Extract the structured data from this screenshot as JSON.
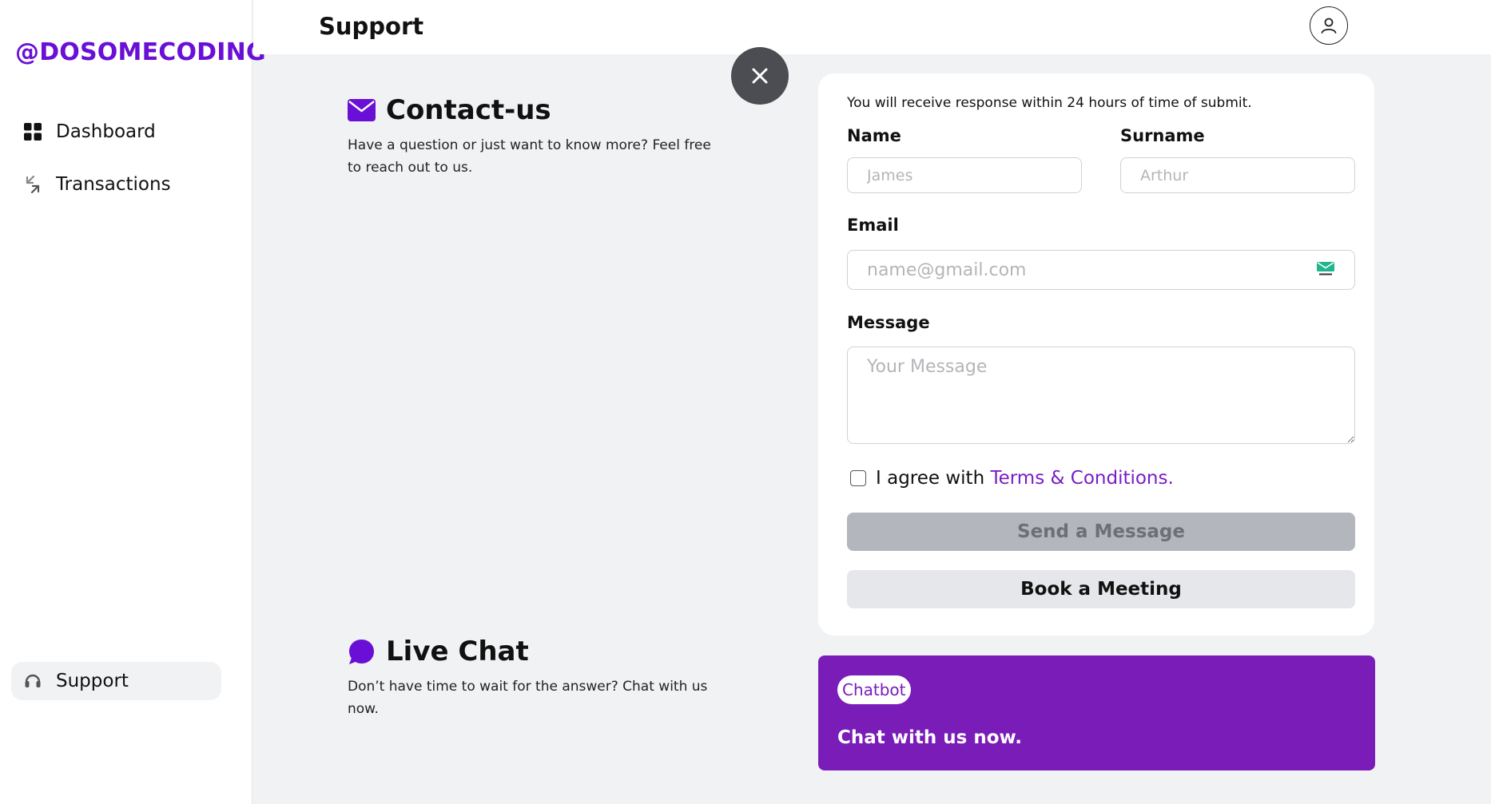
{
  "brand": "@DOSOMECODING",
  "sidebar": {
    "items": [
      {
        "label": "Dashboard",
        "icon": "dashboard-icon"
      },
      {
        "label": "Transactions",
        "icon": "transactions-icon"
      },
      {
        "label": "Support",
        "icon": "headset-icon",
        "active": true
      }
    ]
  },
  "header": {
    "title": "Support",
    "avatar_icon": "user-icon"
  },
  "contact": {
    "title": "Contact-us",
    "description": "Have a question or just want to know more? Feel free to reach out to us.",
    "icon": "envelope-icon"
  },
  "chat": {
    "title": "Live Chat",
    "description": "Don’t have time to wait for the answer? Chat with us now.",
    "icon": "chat-bubble-icon"
  },
  "form": {
    "notice": "You will receive response within 24 hours of time of submit.",
    "name_label": "Name",
    "name_placeholder": "James",
    "surname_label": "Surname",
    "surname_placeholder": "Arthur",
    "email_label": "Email",
    "email_placeholder": "name@gmail.com",
    "message_label": "Message",
    "message_placeholder": "Your Message",
    "agree_text": "I agree with",
    "terms_link": "Terms & Conditions.",
    "send_button": "Send a Message",
    "book_button": "Book a Meeting"
  },
  "chatbot": {
    "badge": "Chatbot",
    "text": "Chat with us now."
  },
  "colors": {
    "brand": "#6a0fd6",
    "chatbot_bg": "#7a1cb8",
    "background": "#f1f2f4"
  }
}
